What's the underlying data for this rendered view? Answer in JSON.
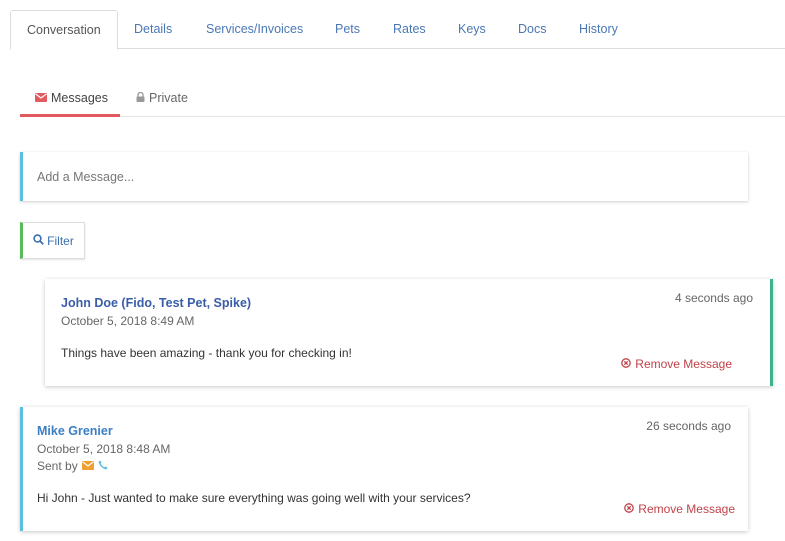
{
  "tabs": [
    {
      "label": "Conversation",
      "active": true
    },
    {
      "label": "Details"
    },
    {
      "label": "Services/Invoices"
    },
    {
      "label": "Pets"
    },
    {
      "label": "Rates"
    },
    {
      "label": "Keys"
    },
    {
      "label": "Docs"
    },
    {
      "label": "History"
    }
  ],
  "subtabs": {
    "messages": {
      "label": "Messages",
      "icon": "envelope-icon"
    },
    "private": {
      "label": "Private",
      "icon": "lock-icon"
    }
  },
  "composer": {
    "placeholder": "Add a Message..."
  },
  "filter": {
    "label": "Filter",
    "icon": "search-icon"
  },
  "messages": [
    {
      "author": "John Doe (Fido, Test Pet, Spike)",
      "date": "October 5, 2018 8:49 AM",
      "ago": "4 seconds ago",
      "body": "Things have been amazing - thank you for checking in!",
      "remove_label": "Remove Message"
    },
    {
      "author": "Mike Grenier",
      "date": "October 5, 2018 8:48 AM",
      "sent_by_label": "Sent by",
      "sent_by_icons": [
        "envelope-icon",
        "phone-icon"
      ],
      "ago": "26 seconds ago",
      "body": "Hi John - Just wanted to make sure everything was going well with your services?",
      "remove_label": "Remove Message"
    }
  ],
  "colors": {
    "link": "#4a78b5",
    "active_underline": "#e25a5f",
    "info_border": "#5bc0de",
    "success_border": "#5cb85c",
    "card_accent": "#3cb48a",
    "remove": "#c0424a",
    "envelope_orange": "#f0a030",
    "phone_blue": "#5bc0de"
  }
}
